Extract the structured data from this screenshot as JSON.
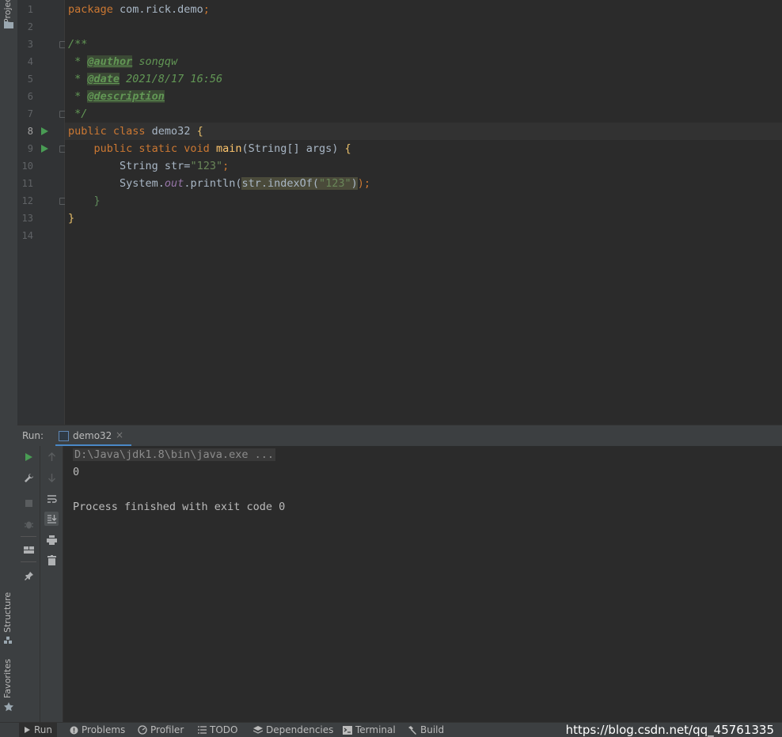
{
  "left_stripe": {
    "project_label": "Project",
    "structure_label": "Structure",
    "favorites_label": "Favorites"
  },
  "editor": {
    "line_numbers": [
      "1",
      "2",
      "3",
      "4",
      "5",
      "6",
      "7",
      "8",
      "9",
      "10",
      "11",
      "12",
      "13",
      "14"
    ],
    "code": {
      "l1_kw": "package",
      "l1_rest": " com.rick.demo",
      "l1_semi": ";",
      "l3": "/**",
      "l4_star": " * ",
      "l4_tag": "@author",
      "l4_val": " songqw",
      "l5_star": " * ",
      "l5_tag": "@date",
      "l5_val": " 2021/8/17 16:56",
      "l6_star": " * ",
      "l6_tag": "@description",
      "l7": " */",
      "l8_kw": "public class",
      "l8_name": " demo32 ",
      "l8_brace": "{",
      "l9_indent": "    ",
      "l9_kw": "public static void",
      "l9_sp": " ",
      "l9_fn": "main",
      "l9_args": "(String[] args) ",
      "l9_brace": "{",
      "l10_a": "        String str=",
      "l10_str": "\"123\"",
      "l10_semi": ";",
      "l11_a": "        System.",
      "l11_out": "out",
      "l11_b": ".println(",
      "l11_hl": "str.indexOf(",
      "l11_str": "\"123\"",
      "l11_close": ")",
      "l11_end": ");",
      "l12": "    }",
      "l13": "}"
    }
  },
  "run_window": {
    "label": "Run:",
    "tab_label": "demo32",
    "tab_close": "×",
    "console_lines": [
      "D:\\Java\\jdk1.8\\bin\\java.exe ...",
      "0",
      "",
      "Process finished with exit code 0"
    ]
  },
  "bottom_bar": {
    "tabs": [
      "Run",
      "Problems",
      "Profiler",
      "TODO",
      "Dependencies",
      "Terminal",
      "Build"
    ],
    "watermark": "https://blog.csdn.net/qq_45761335"
  },
  "colors": {
    "background": "#2b2b2b",
    "keyword": "#cc7832",
    "comment": "#629755",
    "string": "#6a8759",
    "method": "#ffc66d",
    "run_green": "#499c54",
    "accent_blue": "#4a88c7"
  }
}
